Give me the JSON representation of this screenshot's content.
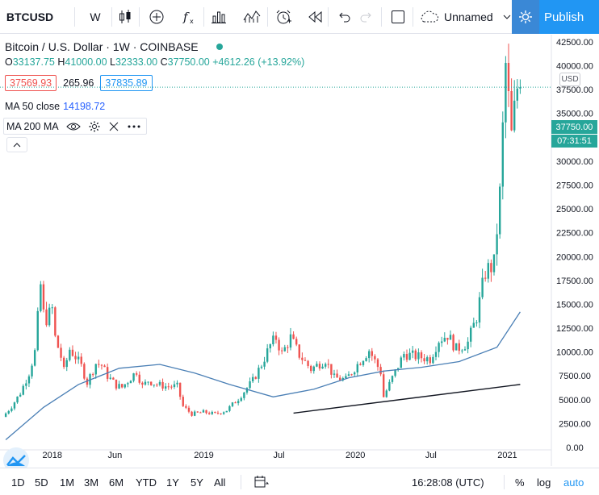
{
  "toolbar": {
    "symbol": "BTCUSD",
    "interval": "W",
    "layout_name": "Unnamed",
    "publish_label": "Publish"
  },
  "legend": {
    "title": "Bitcoin / U.S. Dollar · 1W · COINBASE",
    "o_key": "O",
    "o_val": "33137.75",
    "h_key": "H",
    "h_val": "41000.00",
    "l_key": "L",
    "l_val": "32333.00",
    "c_key": "C",
    "c_val": "37750.00",
    "change": "+4612.26 (+13.92%)",
    "bid": "37569.93",
    "spread": "265.96",
    "ask": "37835.89",
    "ma50_label": "MA 50 close",
    "ma50_value": "14198.72",
    "ma200_label": "MA 200 MA"
  },
  "price_axis": {
    "currency": "USD",
    "labels": [
      "42500.00",
      "40000.00",
      "37500.00",
      "35000.00",
      "32500.00",
      "30000.00",
      "27500.00",
      "25000.00",
      "22500.00",
      "20000.00",
      "17500.00",
      "15000.00",
      "12500.00",
      "10000.00",
      "7500.00",
      "5000.00",
      "2500.00",
      "0.00"
    ],
    "last_price": "37750.00",
    "countdown": "07:31:51"
  },
  "time_axis": {
    "labels": [
      "2018",
      "Jun",
      "2019",
      "Jul",
      "2020",
      "Jul",
      "2021"
    ]
  },
  "bottombar": {
    "ranges": [
      "1D",
      "5D",
      "1M",
      "3M",
      "6M",
      "YTD",
      "1Y",
      "5Y",
      "All"
    ],
    "clock": "16:28:08 (UTC)",
    "percent": "%",
    "log": "log",
    "auto": "auto"
  },
  "colors": {
    "up": "#26a69a",
    "down": "#ef5350",
    "ma50": "#4a7fb5",
    "accent": "#2196f3",
    "trendline": "#131722"
  },
  "chart_data": {
    "type": "candlestick",
    "title": "Bitcoin / U.S. Dollar · 1W · COINBASE",
    "ylim": [
      0,
      43000
    ],
    "x_range": [
      "2017-09",
      "2021-02"
    ],
    "weekly_close_path": [
      [
        "2017-09-11",
        3200
      ],
      [
        "2017-10-02",
        4300
      ],
      [
        "2017-10-23",
        5700
      ],
      [
        "2017-11-13",
        7800
      ],
      [
        "2017-11-27",
        10000
      ],
      [
        "2017-12-11",
        17000
      ],
      [
        "2017-12-18",
        14000
      ],
      [
        "2017-12-25",
        13500
      ],
      [
        "2018-01-08",
        14500
      ],
      [
        "2018-01-15",
        11500
      ],
      [
        "2018-01-29",
        9500
      ],
      [
        "2018-02-05",
        8000
      ],
      [
        "2018-02-19",
        10300
      ],
      [
        "2018-03-05",
        9500
      ],
      [
        "2018-03-19",
        8500
      ],
      [
        "2018-04-02",
        6800
      ],
      [
        "2018-04-23",
        8800
      ],
      [
        "2018-05-07",
        8600
      ],
      [
        "2018-05-21",
        7500
      ],
      [
        "2018-06-11",
        6500
      ],
      [
        "2018-06-25",
        6300
      ],
      [
        "2018-07-16",
        7300
      ],
      [
        "2018-07-30",
        8000
      ],
      [
        "2018-08-13",
        6400
      ],
      [
        "2018-08-27",
        7000
      ],
      [
        "2018-09-17",
        6600
      ],
      [
        "2018-10-08",
        6400
      ],
      [
        "2018-11-05",
        6400
      ],
      [
        "2018-11-19",
        4300
      ],
      [
        "2018-12-10",
        3500
      ],
      [
        "2019-01-07",
        3700
      ],
      [
        "2019-02-04",
        3500
      ],
      [
        "2019-03-04",
        3900
      ],
      [
        "2019-04-01",
        5100
      ],
      [
        "2019-05-06",
        7000
      ],
      [
        "2019-05-27",
        8700
      ],
      [
        "2019-06-17",
        10700
      ],
      [
        "2019-07-01",
        11500
      ],
      [
        "2019-07-15",
        9800
      ],
      [
        "2019-08-05",
        11500
      ],
      [
        "2019-08-26",
        9700
      ],
      [
        "2019-09-23",
        8200
      ],
      [
        "2019-10-28",
        9200
      ],
      [
        "2019-11-18",
        7300
      ],
      [
        "2019-12-16",
        7100
      ],
      [
        "2020-01-13",
        8700
      ],
      [
        "2020-02-10",
        10200
      ],
      [
        "2020-03-09",
        7900
      ],
      [
        "2020-03-16",
        5300
      ],
      [
        "2020-04-06",
        7300
      ],
      [
        "2020-05-04",
        9800
      ],
      [
        "2020-06-08",
        9500
      ],
      [
        "2020-07-06",
        9300
      ],
      [
        "2020-07-27",
        11300
      ],
      [
        "2020-08-17",
        11800
      ],
      [
        "2020-09-07",
        10300
      ],
      [
        "2020-10-05",
        11000
      ],
      [
        "2020-10-26",
        13700
      ],
      [
        "2020-11-16",
        18400
      ],
      [
        "2020-12-07",
        19200
      ],
      [
        "2020-12-21",
        26500
      ],
      [
        "2021-01-04",
        40000
      ],
      [
        "2021-01-18",
        32500
      ],
      [
        "2021-02-01",
        37750
      ]
    ],
    "ma50_path": [
      [
        "2017-09-11",
        800
      ],
      [
        "2017-12-11",
        4200
      ],
      [
        "2018-03-05",
        6600
      ],
      [
        "2018-06-11",
        8300
      ],
      [
        "2018-09-17",
        8700
      ],
      [
        "2018-12-10",
        7800
      ],
      [
        "2019-03-04",
        6600
      ],
      [
        "2019-06-17",
        5300
      ],
      [
        "2019-09-23",
        6100
      ],
      [
        "2019-12-16",
        7300
      ],
      [
        "2020-03-09",
        8000
      ],
      [
        "2020-06-08",
        8400
      ],
      [
        "2020-09-07",
        9000
      ],
      [
        "2020-12-07",
        10500
      ],
      [
        "2021-02-01",
        14198.72
      ]
    ],
    "trendline": [
      [
        "2019-08-05",
        3600
      ],
      [
        "2021-02-01",
        6600
      ]
    ]
  }
}
